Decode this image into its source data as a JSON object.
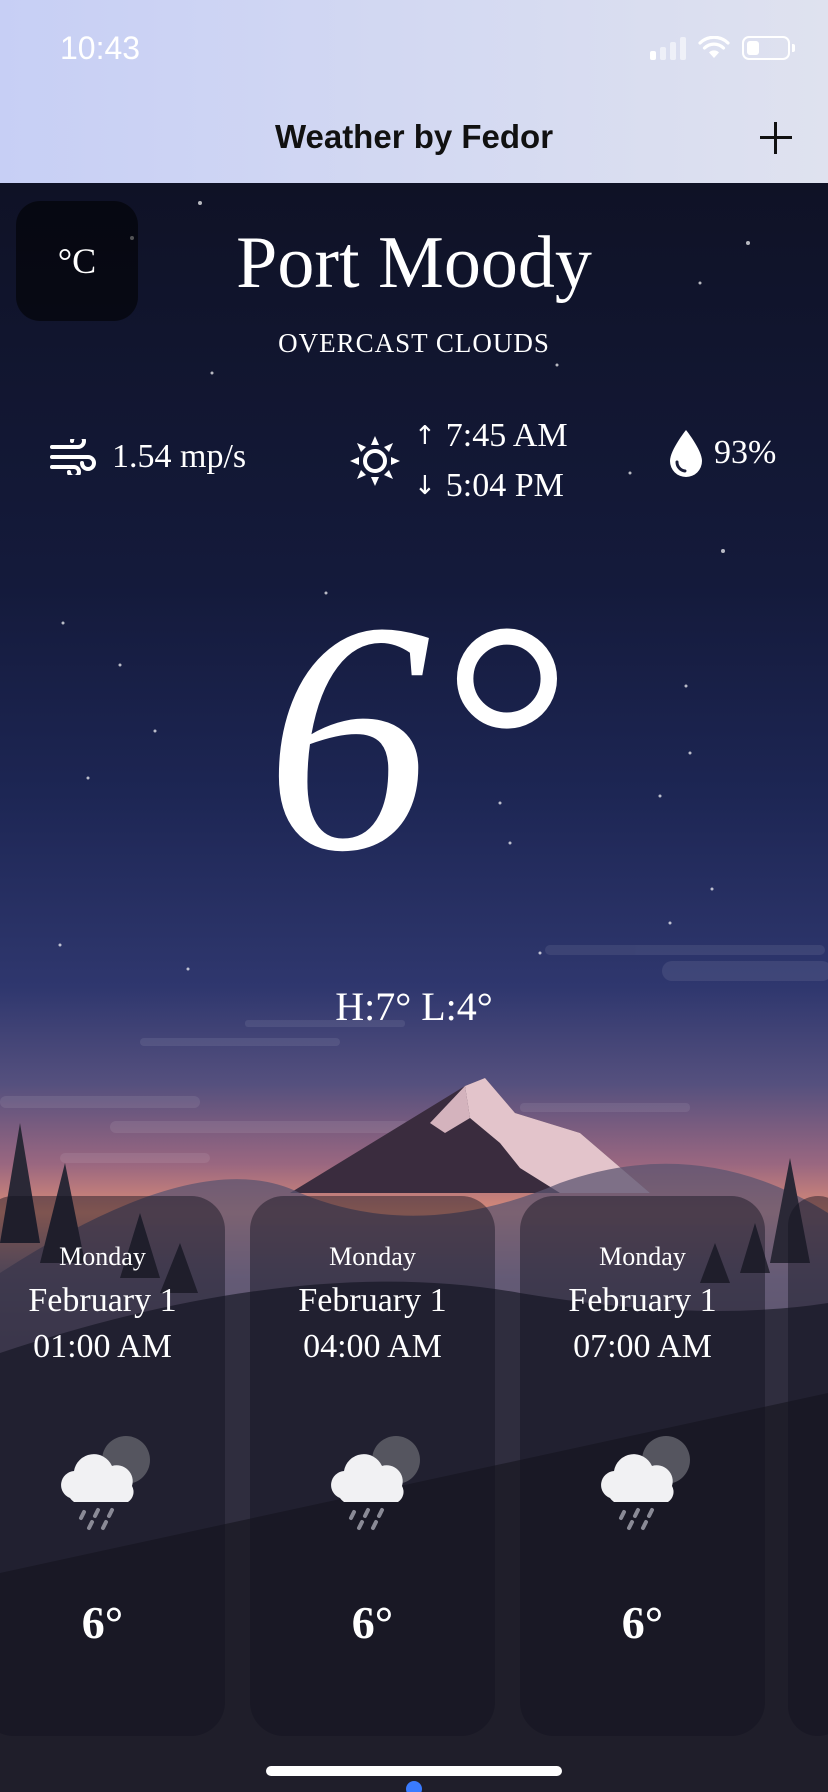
{
  "status_bar": {
    "time": "10:43",
    "signal_bars": 1,
    "battery_level": 0.3
  },
  "nav": {
    "title": "Weather by Fedor",
    "add_icon": "plus-icon"
  },
  "unit_toggle": {
    "label": "°C"
  },
  "location": {
    "city": "Port Moody",
    "condition": "OVERCAST CLOUDS"
  },
  "details": {
    "wind_icon": "wind-icon",
    "wind": "1.54 mp/s",
    "sun_icon": "sun-icon",
    "sunrise": "7:45 AM",
    "sunset": "5:04 PM",
    "humidity_icon": "droplet-icon",
    "humidity": "93%"
  },
  "current": {
    "temp": "6°",
    "hilo": "H:7° L:4°"
  },
  "hourly": [
    {
      "day": "Monday",
      "date": "February 1",
      "time": "01:00 AM",
      "icon": "cloud-rain-moon-icon",
      "temp": "6°"
    },
    {
      "day": "Monday",
      "date": "February 1",
      "time": "04:00 AM",
      "icon": "cloud-rain-moon-icon",
      "temp": "6°"
    },
    {
      "day": "Monday",
      "date": "February 1",
      "time": "07:00 AM",
      "icon": "cloud-rain-moon-icon",
      "temp": "6°"
    }
  ],
  "colors": {
    "accent_dot": "#3a7bff",
    "nav_bg_start": "#c7cff5",
    "nav_bg_end": "#dfe2ef"
  }
}
